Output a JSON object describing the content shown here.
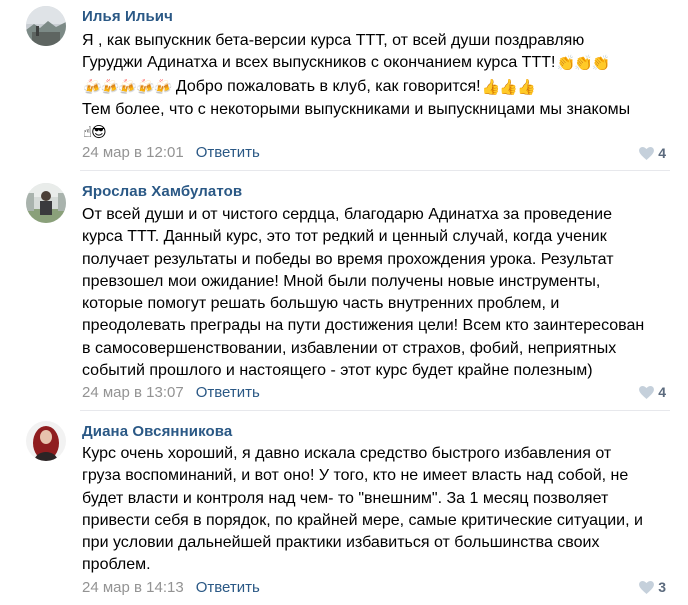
{
  "comments": [
    {
      "author": "Илья Ильич",
      "lines": [
        "Я , как выпускник бета-версии курса ТТТ, от всей души поздравляю",
        "Гуруджи Адинатха и всех выпускников с окончанием курса ТТТ!",
        "Добро пожаловать в клуб, как говорится!",
        "Тем более, что с некоторыми выпускниками и выпускницами мы знакомы"
      ],
      "emoji": {
        "clap": "👏👏👏",
        "beer": "🍻🍻🍻🍻🍻",
        "thumbs": "👍👍👍",
        "end": "☝😎"
      },
      "time": "24 мар в 12:01",
      "reply": "Ответить",
      "likes": "4"
    },
    {
      "author": "Ярослав Хамбулатов",
      "lines": [
        "От всей души и от чистого сердца, благодарю Адинатха за проведение",
        "курса ТТТ. Данный курс, это тот редкий и ценный случай, когда ученик",
        "получает результаты и победы во время прохождения урока. Результат",
        "превзошел мои ожидание! Мной были получены новые инструменты,",
        "которые помогут решать большую часть внутренних проблем, и",
        "преодолевать преграды на пути достижения цели! Всем кто заинтересован",
        "в самосовершенствовании, избавлении от страхов, фобий, неприятных",
        "событий прошлого и настоящего - этот курс будет крайне полезным)"
      ],
      "time": "24 мар в 13:07",
      "reply": "Ответить",
      "likes": "4"
    },
    {
      "author": "Диана Овсянникова",
      "lines": [
        "Курс очень хороший, я давно искала средство быстрого избавления от",
        "груза воспоминаний, и вот оно! У того, кто не имеет власть над собой, не",
        "будет власти и контроля над чем- то \"внешним\". За 1 месяц позволяет",
        "привести себя в порядок, по крайней мере, самые критические ситуации, и",
        "при условии дальнейшей практики избавиться от большинства своих",
        "проблем."
      ],
      "time": "24 мар в 14:13",
      "reply": "Ответить",
      "likes": "3"
    }
  ],
  "colors": {
    "author": "#2a5885",
    "meta": "#939393",
    "separator": "#e7e8ec",
    "likes": "#5b6a7d"
  }
}
